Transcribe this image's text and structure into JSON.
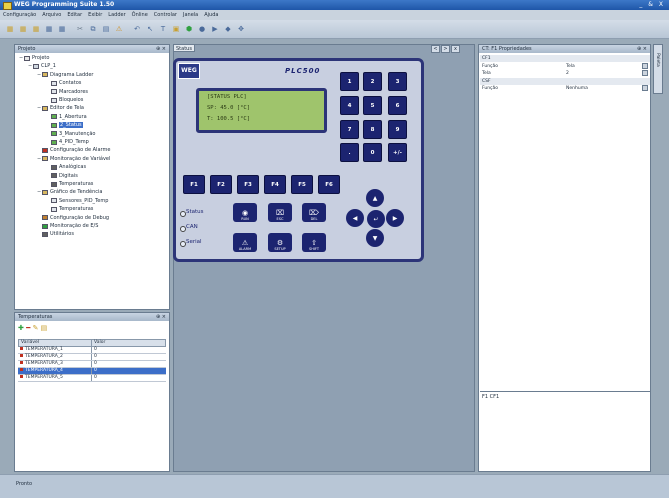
{
  "window": {
    "title": "WEG Programming Suite 1.50",
    "controls": "_ & X"
  },
  "menu": [
    "Configuração",
    "Arquivo",
    "Editar",
    "Exibir",
    "Ladder",
    "Ônline",
    "Controlar",
    "Janela",
    "Ajuda"
  ],
  "toolbar": {
    "icons": [
      {
        "name": "new-icon",
        "glyph": "▦",
        "color": "#c8a030"
      },
      {
        "name": "open-icon",
        "glyph": "▦",
        "color": "#c8a030"
      },
      {
        "name": "save-icon",
        "glyph": "▦",
        "color": "#c8a030"
      },
      {
        "name": "print-icon",
        "glyph": "▦",
        "color": "#4a6a9a"
      },
      {
        "name": "network-icon",
        "glyph": "▦",
        "color": "#4a6a9a"
      },
      {
        "name": "cut-icon",
        "glyph": "✂",
        "color": "#6a7a8a"
      },
      {
        "name": "copy-icon",
        "glyph": "⧉",
        "color": "#4a6a9a"
      },
      {
        "name": "paste-icon",
        "glyph": "▤",
        "color": "#4a6a9a"
      },
      {
        "name": "warning-icon",
        "glyph": "⚠",
        "color": "#d09020"
      },
      {
        "name": "undo-icon",
        "glyph": "↶",
        "color": "#4a6a9a"
      },
      {
        "name": "pointer-icon",
        "glyph": "↖",
        "color": "#4a6a9a"
      },
      {
        "name": "text-icon",
        "glyph": "T",
        "color": "#4a6a9a"
      },
      {
        "name": "image-icon",
        "glyph": "▣",
        "color": "#c8a030"
      },
      {
        "name": "download-icon",
        "glyph": "⬢",
        "color": "#30a040"
      },
      {
        "name": "record-icon",
        "glyph": "●",
        "color": "#4a6a9a"
      },
      {
        "name": "run-icon",
        "glyph": "▶",
        "color": "#4a6a9a"
      },
      {
        "name": "stop-icon",
        "glyph": "◆",
        "color": "#4a6a9a"
      },
      {
        "name": "settings-icon",
        "glyph": "✥",
        "color": "#4a6a9a"
      }
    ]
  },
  "project_panel": {
    "title": "Projeto",
    "tree": [
      {
        "label": "Projeto",
        "level": 0,
        "exp": "−",
        "icon": "#e8e8e8"
      },
      {
        "label": "CLP_1",
        "level": 1,
        "exp": "−",
        "icon": "#d0d8e0"
      },
      {
        "label": "Diagrama Ladder",
        "level": 2,
        "exp": "−",
        "icon": "#d8b860"
      },
      {
        "label": "Contatos",
        "level": 3,
        "exp": "",
        "icon": "#e0e4ea"
      },
      {
        "label": "Marcadores",
        "level": 3,
        "exp": "",
        "icon": "#e0e4ea"
      },
      {
        "label": "Bloqueios",
        "level": 3,
        "exp": "",
        "icon": "#e0e4ea"
      },
      {
        "label": "Editor de Tela",
        "level": 2,
        "exp": "−",
        "icon": "#d8b860"
      },
      {
        "label": "1_Abertura",
        "level": 3,
        "exp": "",
        "icon": "#60b050"
      },
      {
        "label": "2_Status",
        "level": 3,
        "exp": "",
        "icon": "#60b050",
        "sel": true
      },
      {
        "label": "3_Manutenção",
        "level": 3,
        "exp": "",
        "icon": "#60b050"
      },
      {
        "label": "4_PID_Temp",
        "level": 3,
        "exp": "",
        "icon": "#60b050"
      },
      {
        "label": "Configuração de Alarme",
        "level": 2,
        "exp": "",
        "icon": "#c03020"
      },
      {
        "label": "Monitoração de Variável",
        "level": 2,
        "exp": "−",
        "icon": "#d8b860"
      },
      {
        "label": "Analógicas",
        "level": 3,
        "exp": "",
        "icon": "#606060"
      },
      {
        "label": "Digitais",
        "level": 3,
        "exp": "",
        "icon": "#606060"
      },
      {
        "label": "Temperaturas",
        "level": 3,
        "exp": "",
        "icon": "#606060"
      },
      {
        "label": "Gráfico de Tendência",
        "level": 2,
        "exp": "−",
        "icon": "#d8b860"
      },
      {
        "label": "Sensores_PID_Temp",
        "level": 3,
        "exp": "",
        "icon": "#e0e4ea"
      },
      {
        "label": "Temperaturas",
        "level": 3,
        "exp": "",
        "icon": "#e0e4ea"
      },
      {
        "label": "Configuração de Debug",
        "level": 2,
        "exp": "",
        "icon": "#c08030"
      },
      {
        "label": "Monitoração de E/S",
        "level": 2,
        "exp": "",
        "icon": "#30a040"
      },
      {
        "label": "Utilitários",
        "level": 2,
        "exp": "",
        "icon": "#606060"
      }
    ]
  },
  "temps_panel": {
    "title": "Temperaturas",
    "columns": [
      "Variável",
      "Valor"
    ],
    "rows": [
      {
        "name": "TEMPERATURA_1",
        "value": "0"
      },
      {
        "name": "TEMPERATURA_2",
        "value": "0"
      },
      {
        "name": "TEMPERATURA_3",
        "value": "0"
      },
      {
        "name": "TEMPERATURA_4",
        "value": "0",
        "sel": true
      },
      {
        "name": "TEMPERATURA_5",
        "value": "0"
      }
    ]
  },
  "document": {
    "tab": "Status",
    "controls": [
      "<",
      ">",
      "x"
    ]
  },
  "device": {
    "logo": "WEG",
    "brand": "PLC500",
    "lcd": [
      "[STATUS PLC]",
      "SP: 45.0 [°C]",
      "T: 100.5 [°C]"
    ],
    "numkeys": [
      "1",
      "2",
      "3",
      "4",
      "5",
      "6",
      "7",
      "8",
      "9",
      ".",
      "0",
      "+/-"
    ],
    "fkeys": [
      "F1",
      "F2",
      "F3",
      "F4",
      "F5",
      "F6"
    ],
    "status_leds": [
      "Status",
      "CAN",
      "Serial"
    ],
    "controls": [
      {
        "label": "RUN",
        "sym": "◉",
        "name": "run-button"
      },
      {
        "label": "ESC",
        "sym": "⌧",
        "name": "esc-button"
      },
      {
        "label": "DEL",
        "sym": "⌦",
        "name": "del-button"
      },
      {
        "label": "ALARM",
        "sym": "⚠",
        "name": "alarm-button"
      },
      {
        "label": "SETUP",
        "sym": "⚙",
        "name": "setup-button"
      },
      {
        "label": "SHIFT",
        "sym": "⇧",
        "name": "shift-button"
      }
    ],
    "dpad": {
      "up": "▲",
      "down": "▼",
      "left": "◀",
      "right": "▶",
      "enter": "↵"
    }
  },
  "properties": {
    "title": "CT: F1 Propriedades",
    "rows": [
      {
        "k": "CF1",
        "v": "",
        "cat": true,
        "btn": false
      },
      {
        "k": "Função",
        "v": "Tela",
        "cat": false,
        "btn": true
      },
      {
        "k": "Tela",
        "v": "2",
        "cat": false,
        "btn": true
      },
      {
        "k": "CSF",
        "v": "",
        "cat": true,
        "btn": false
      },
      {
        "k": "Função",
        "v": "Nenhuma",
        "cat": false,
        "btn": true
      }
    ],
    "desc_title": "F1 CF1"
  },
  "sidetab": "Paleta",
  "status": {
    "text": "Pronto"
  }
}
